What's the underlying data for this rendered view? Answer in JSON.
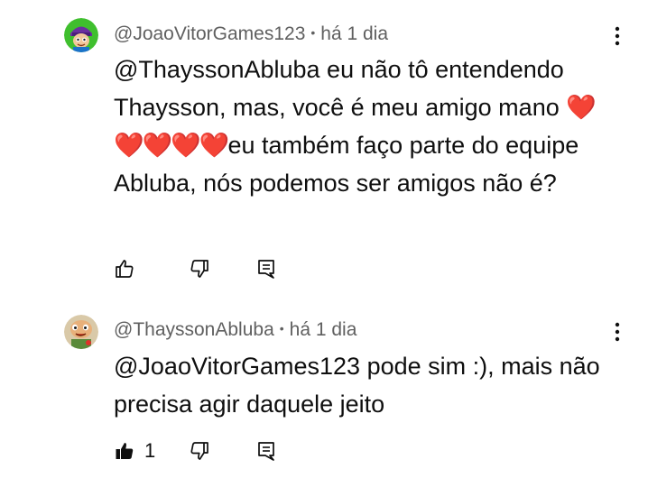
{
  "comments": [
    {
      "author": "@JoaoVitorGames123",
      "time": "há 1 dia",
      "mention": "@ThayssonAbluba",
      "text_part1": " eu não tô entendendo Thaysson, mas, você é meu amigo mano",
      "hearts": "❤️❤️❤️❤️❤️",
      "text_part2": "eu também faço parte do equipe Abluba, nós podemos ser amigos não é?",
      "like_count": "",
      "liked": false,
      "avatar_icon": "green-cartoon-avatar"
    },
    {
      "author": "@ThayssonAbluba",
      "time": "há 1 dia",
      "mention": "@JoaoVitorGames123",
      "text_part1": " pode sim :), mais não precisa agir daquele jeito",
      "hearts": "",
      "text_part2": "",
      "like_count": "1",
      "liked": true,
      "avatar_icon": "cartoon-character-avatar"
    }
  ],
  "icons": {
    "like": "thumbs-up-icon",
    "dislike": "thumbs-down-icon",
    "reply": "reply-comment-icon",
    "more": "more-vertical-icon"
  },
  "colors": {
    "text": "#0f0f0f",
    "meta": "#606060",
    "heart": "#e3261b"
  }
}
